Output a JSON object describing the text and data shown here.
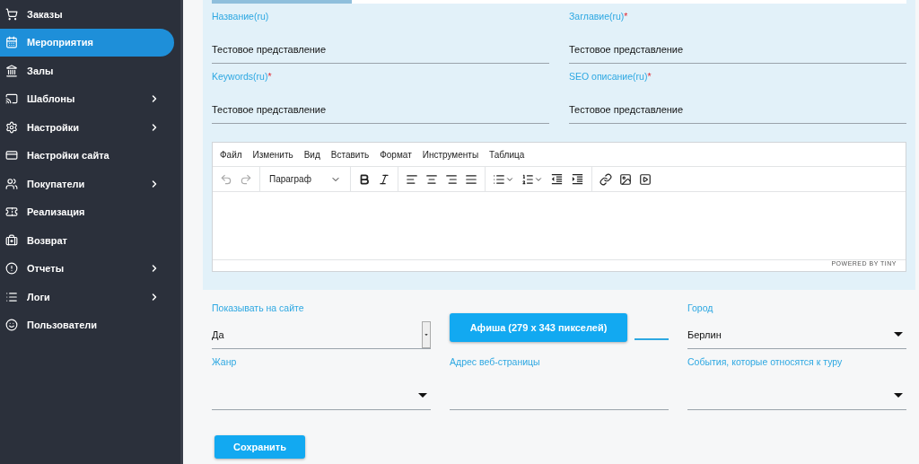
{
  "sidebar": {
    "items": [
      {
        "label": "Заказы",
        "selected": false,
        "has_submenu": false
      },
      {
        "label": "Мероприятия",
        "selected": true,
        "has_submenu": false
      },
      {
        "label": "Залы",
        "selected": false,
        "has_submenu": false
      },
      {
        "label": "Шаблоны",
        "selected": false,
        "has_submenu": true
      },
      {
        "label": "Настройки",
        "selected": false,
        "has_submenu": true
      },
      {
        "label": "Настройки сайта",
        "selected": false,
        "has_submenu": false
      },
      {
        "label": "Покупатели",
        "selected": false,
        "has_submenu": true
      },
      {
        "label": "Реализация",
        "selected": false,
        "has_submenu": false
      },
      {
        "label": "Возврат",
        "selected": false,
        "has_submenu": false
      },
      {
        "label": "Отчеты",
        "selected": false,
        "has_submenu": true
      },
      {
        "label": "Логи",
        "selected": false,
        "has_submenu": true
      },
      {
        "label": "Пользователи",
        "selected": false,
        "has_submenu": false
      }
    ]
  },
  "translation_fields": [
    {
      "label": "Название(ru)",
      "required": false,
      "value": "Тестовое представление"
    },
    {
      "label": "Заглавие(ru)",
      "required": true,
      "value": "Тестовое представление"
    },
    {
      "label": "Keywords(ru)",
      "required": true,
      "value": "Тестовое представление"
    },
    {
      "label": "SEO описание(ru)",
      "required": true,
      "value": "Тестовое представление"
    }
  ],
  "required_mark": "*",
  "editor": {
    "menu": [
      "Файл",
      "Изменить",
      "Вид",
      "Вставить",
      "Формат",
      "Инструменты",
      "Таблица"
    ],
    "undo_disabled": true,
    "redo_disabled": true,
    "block_format": "Параграф",
    "branding": "POWERED BY TINY"
  },
  "show_on_site": {
    "label": "Показывать на сайте",
    "value": "Да"
  },
  "poster_button": "Афиша (279 x 343 пикселей)",
  "city": {
    "label": "Город",
    "value": "Берлин"
  },
  "genre": {
    "label": "Жанр"
  },
  "web_address": {
    "label": "Адрес веб-страницы"
  },
  "tour_events": {
    "label": "События, которые относятся к туру"
  },
  "save_button": "Сохранить"
}
